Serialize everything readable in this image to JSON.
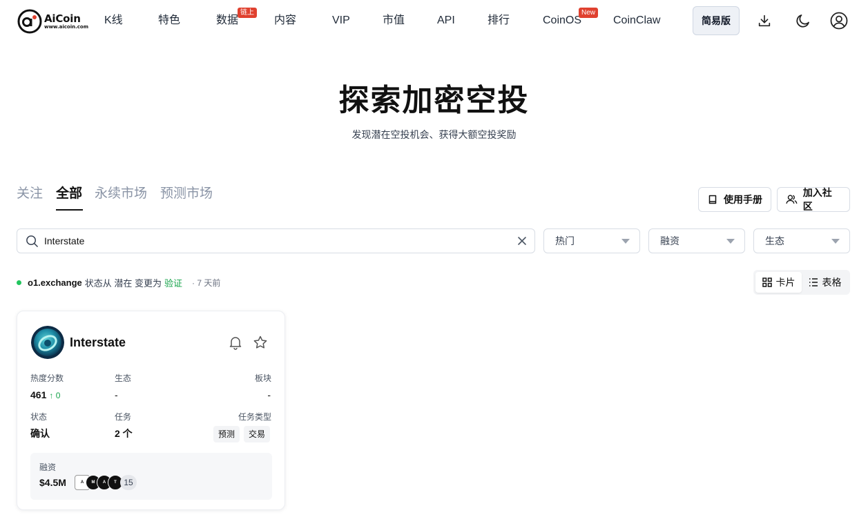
{
  "header": {
    "logo": {
      "name": "AiCoin",
      "url": "www.aicoin.com"
    },
    "nav": [
      {
        "label": "K线"
      },
      {
        "label": "特色"
      },
      {
        "label": "数据",
        "badge": "链上"
      },
      {
        "label": "内容"
      },
      {
        "label": "VIP"
      },
      {
        "label": "市值"
      },
      {
        "label": "API"
      },
      {
        "label": "排行"
      },
      {
        "label": "CoinOS",
        "badge": "New"
      },
      {
        "label": "CoinClaw"
      }
    ],
    "simple_label": "简易版",
    "icons": [
      "download-icon",
      "moon-icon",
      "user-icon"
    ]
  },
  "hero": {
    "title": "探索加密空投",
    "subtitle": "发现潜在空投机会、获得大额空投奖励"
  },
  "tabs": [
    {
      "label": "关注",
      "active": false
    },
    {
      "label": "全部",
      "active": true
    },
    {
      "label": "永续市场",
      "active": false
    },
    {
      "label": "预测市场",
      "active": false
    }
  ],
  "actions": {
    "manual": "使用手册",
    "community": "加入社区"
  },
  "filters": {
    "search_value": "Interstate",
    "selects": [
      "热门",
      "融资",
      "生态"
    ]
  },
  "status": {
    "project": "o1.exchange",
    "text_before": "状态从 潜在 变更为",
    "new_state": "验证",
    "time": "· 7 天前"
  },
  "view_toggle": {
    "card": "卡片",
    "table": "表格",
    "active": "card"
  },
  "card": {
    "name": "Interstate",
    "heat_label": "热度分数",
    "heat_value": "461",
    "heat_delta": "↑ 0",
    "eco_label": "生态",
    "eco_value": "-",
    "sector_label": "板块",
    "sector_value": "-",
    "state_label": "状态",
    "state_value": "确认",
    "task_label": "任务",
    "task_value": "2 个",
    "task_type_label": "任务类型",
    "task_types": [
      "预测",
      "交易"
    ],
    "funding_label": "融资",
    "funding_value": "$4.5M",
    "investor_more": "15"
  },
  "colors": {
    "accent_green": "#16a34a",
    "badge_red": "#e0412f"
  }
}
